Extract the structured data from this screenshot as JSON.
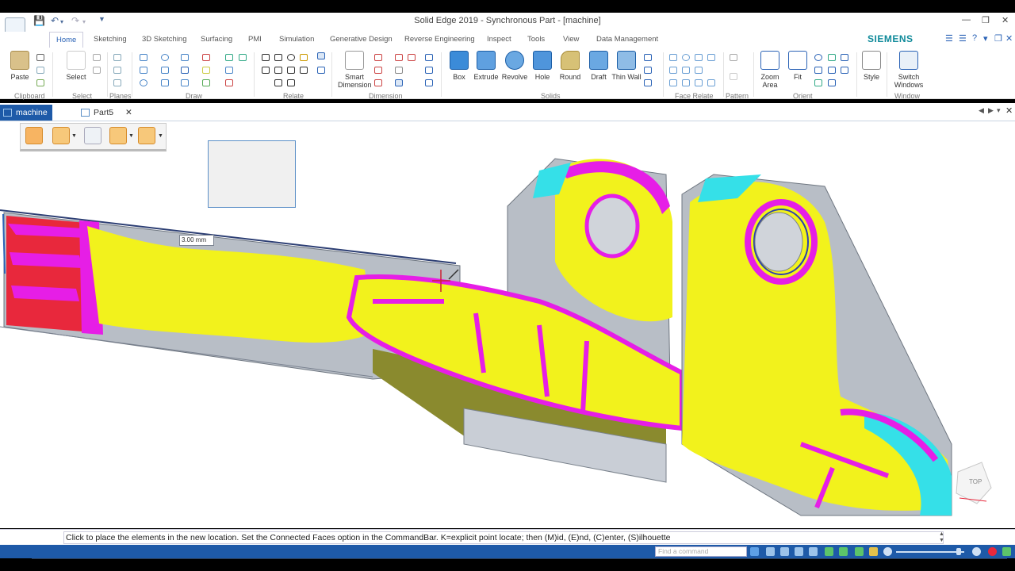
{
  "window": {
    "title": "Solid Edge 2019 - Synchronous Part - [machine]",
    "brand": "SIEMENS"
  },
  "ribbon_tabs": [
    {
      "label": "Home",
      "active": true
    },
    {
      "label": "Sketching"
    },
    {
      "label": "3D Sketching"
    },
    {
      "label": "Surfacing"
    },
    {
      "label": "PMI"
    },
    {
      "label": "Simulation"
    },
    {
      "label": "Generative Design"
    },
    {
      "label": "Reverse Engineering"
    },
    {
      "label": "Inspect"
    },
    {
      "label": "Tools"
    },
    {
      "label": "View"
    },
    {
      "label": "Data Management"
    }
  ],
  "ribbon": {
    "buttons": {
      "paste": "Paste",
      "select": "Select",
      "smart_dimension": "Smart Dimension",
      "box": "Box",
      "extrude": "Extrude",
      "revolve": "Revolve",
      "hole": "Hole",
      "round": "Round",
      "draft": "Draft",
      "thin_wall": "Thin Wall",
      "zoom_area": "Zoom Area",
      "fit": "Fit",
      "style": "Style",
      "switch_windows": "Switch Windows"
    },
    "groups": [
      "Clipboard",
      "Select",
      "Planes",
      "Draw",
      "Relate",
      "Dimension",
      "Solids",
      "Face Relate",
      "Pattern",
      "Orient",
      "Window"
    ]
  },
  "documents": [
    {
      "label": "machine",
      "active": true
    },
    {
      "label": "Part5",
      "active": false
    }
  ],
  "viewport": {
    "dimension_value": "3.00 mm",
    "view_cube_label": "TOP"
  },
  "status": {
    "prompt": "Click to place the elements in the new location.  Set the Connected Faces option in the CommandBar.  K=explicit point locate; then (M)id, (E)nd, (C)enter, (S)ilhouette",
    "find_placeholder": "Find a command"
  },
  "colors": {
    "accent": "#1e5aa8",
    "brand": "#0f8a9a",
    "mesh_yellow": "#f2f21c",
    "mesh_magenta": "#e61ee6",
    "mesh_cyan": "#35e0e8",
    "mesh_red": "#e8283c",
    "body_gray": "#b8bec6"
  }
}
